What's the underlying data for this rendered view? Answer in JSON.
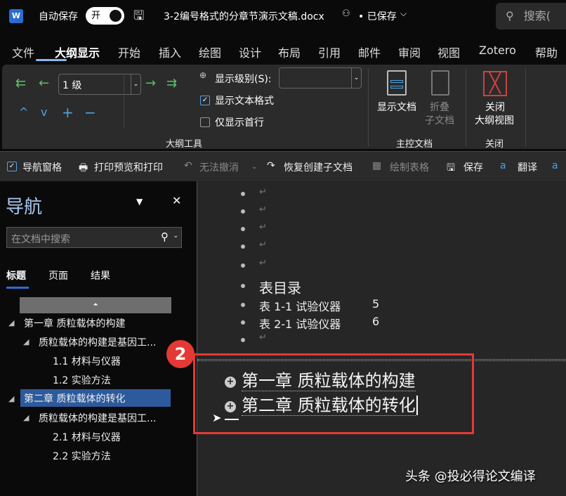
{
  "titlebar": {
    "app_icon": "W",
    "autosave_label": "自动保存",
    "autosave_state": "开",
    "filename": "3-2编号格式的分章节演示文稿.docx",
    "save_status": "• 已保存",
    "search_placeholder": "搜索("
  },
  "tabs": [
    "文件",
    "大纲显示",
    "开始",
    "插入",
    "绘图",
    "设计",
    "布局",
    "引用",
    "邮件",
    "审阅",
    "视图",
    "Zotero",
    "帮助"
  ],
  "ribbon": {
    "level_value": "1 级",
    "show_level_label": "显示级别(S):",
    "show_level_value": "",
    "show_text_format": {
      "label": "显示文本格式",
      "checked": true
    },
    "first_line_only": {
      "label": "仅显示首行",
      "checked": false
    },
    "outline_tools_group": "大纲工具",
    "show_document": "显示文档",
    "collapse_subdocs": [
      "折叠",
      "子文档"
    ],
    "master_doc_group": "主控文档",
    "close_outline": [
      "关闭",
      "大纲视图"
    ],
    "close_group": "关闭"
  },
  "qat": {
    "nav_pane": "导航窗格",
    "nav_pane_checked": true,
    "print_preview": "打印预览和打印",
    "undo": "无法撤消",
    "redo": "恢复创建子文档",
    "draw_table": "绘制表格",
    "save": "保存",
    "translate": "翻译"
  },
  "nav": {
    "title": "导航",
    "search_placeholder": "在文档中搜索",
    "tabs": [
      "标题",
      "页面",
      "结果"
    ],
    "items": [
      {
        "label": "第一章 质粒载体的构建",
        "level": 1,
        "selected": false
      },
      {
        "label": "质粒载体的构建是基因工...",
        "level": 2,
        "selected": false
      },
      {
        "label": "1.1 材料与仪器",
        "level": 3,
        "selected": false
      },
      {
        "label": "1.2 实验方法",
        "level": 3,
        "selected": false
      },
      {
        "label": "第二章 质粒载体的转化",
        "level": 1,
        "selected": true
      },
      {
        "label": "质粒载体的构建是基因工...",
        "level": 2,
        "selected": false
      },
      {
        "label": "2.1 材料与仪器",
        "level": 3,
        "selected": false
      },
      {
        "label": "2.2 实验方法",
        "level": 3,
        "selected": false
      }
    ]
  },
  "doc": {
    "return_mark": "↵",
    "toc_title": "表目录",
    "toc_rows": [
      {
        "label": "表 1-1 试验仪器",
        "page": "5"
      },
      {
        "label": "表 2-1 试验仪器",
        "page": "6"
      }
    ],
    "headings": [
      "第一章 质粒载体的构建",
      "第二章 质粒载体的转化"
    ],
    "badge": "2"
  },
  "watermark": "头条 @投必得论文编译"
}
